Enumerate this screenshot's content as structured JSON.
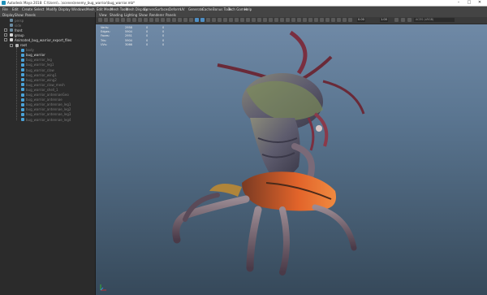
{
  "window": {
    "title": "Autodesk Maya 2018: C:\\Users\\...\\scenes\\enemy_bug_warrior\\bug_warrior.mb*",
    "controls": [
      "–",
      "□",
      "✕"
    ]
  },
  "menubar": [
    "File",
    "Edit",
    "Create",
    "Select",
    "Modify",
    "Display",
    "Windows",
    "Mesh",
    "Edit Mesh",
    "Mesh Tools",
    "Mesh Display",
    "Curves",
    "Surfaces",
    "Deform",
    "UV",
    "Generate",
    "Cache",
    "Bonus Tools",
    "Tech Games",
    "Help"
  ],
  "outliner": {
    "menu": [
      "Display",
      "Show",
      "Panels"
    ],
    "items": [
      {
        "label": "persp",
        "indent": 0,
        "expand": false,
        "icon": "camera-icon",
        "dim": true
      },
      {
        "label": "side",
        "indent": 0,
        "expand": false,
        "icon": "camera-icon",
        "dim": true
      },
      {
        "label": "front",
        "indent": 0,
        "expand": true,
        "icon": "camera-icon",
        "dim": false
      },
      {
        "label": "group",
        "indent": 0,
        "expand": true,
        "icon": "group-icon",
        "dim": false
      },
      {
        "label": "Animated_bug_warrior_export_files",
        "indent": 0,
        "expand": true,
        "icon": "group-icon",
        "dim": false
      },
      {
        "label": "root",
        "indent": 1,
        "expand": true,
        "icon": "joint-icon",
        "dim": false
      },
      {
        "label": "body",
        "indent": 2,
        "expand": false,
        "icon": "mesh-icon",
        "dim": true
      },
      {
        "label": "bug_warrior",
        "indent": 2,
        "expand": false,
        "icon": "mesh-icon",
        "dim": false,
        "selected": false
      },
      {
        "label": "bug_warrior_leg",
        "indent": 2,
        "expand": false,
        "icon": "mesh-icon",
        "dim": true
      },
      {
        "label": "bug_warrior_leg1",
        "indent": 2,
        "expand": false,
        "icon": "mesh-icon",
        "dim": true
      },
      {
        "label": "bug_warrior_claw",
        "indent": 2,
        "expand": false,
        "icon": "mesh-icon",
        "dim": true
      },
      {
        "label": "bug_warrior_wing1",
        "indent": 2,
        "expand": false,
        "icon": "mesh-icon",
        "dim": true
      },
      {
        "label": "bug_warrior_wing2",
        "indent": 2,
        "expand": false,
        "icon": "mesh-icon",
        "dim": true
      },
      {
        "label": "bug_warrior_claw_mesh",
        "indent": 2,
        "expand": false,
        "icon": "mesh-icon",
        "dim": true
      },
      {
        "label": "bug_warrior_shell_1",
        "indent": 2,
        "expand": false,
        "icon": "mesh-icon",
        "dim": true
      },
      {
        "label": "bug_warrior_antennaeGeo",
        "indent": 2,
        "expand": false,
        "icon": "mesh-icon",
        "dim": true
      },
      {
        "label": "bug_warrior_antennae",
        "indent": 2,
        "expand": false,
        "icon": "mesh-icon",
        "dim": true
      },
      {
        "label": "bug_warrior_antennae_leg1",
        "indent": 2,
        "expand": false,
        "icon": "mesh-icon",
        "dim": true
      },
      {
        "label": "bug_warrior_antennae_leg2",
        "indent": 2,
        "expand": false,
        "icon": "mesh-icon",
        "dim": true
      },
      {
        "label": "bug_warrior_antennae_leg3",
        "indent": 2,
        "expand": false,
        "icon": "mesh-icon",
        "dim": true
      },
      {
        "label": "bug_warrior_antennae_leg4",
        "indent": 2,
        "expand": false,
        "icon": "mesh-icon",
        "dim": true
      }
    ]
  },
  "viewport": {
    "menu": [
      "View",
      "Shading",
      "Lighting",
      "Show",
      "Renderer",
      "Panels"
    ],
    "toolbar": {
      "near_clip": "0.00",
      "far_clip": "1.00",
      "color_space": "ACES (sRGB)"
    },
    "hud": [
      {
        "label": "Verts:",
        "a": "2958",
        "b": "0",
        "c": "0"
      },
      {
        "label": "Edges:",
        "a": "5904",
        "b": "0",
        "c": "0"
      },
      {
        "label": "Faces:",
        "a": "2951",
        "b": "0",
        "c": "0"
      },
      {
        "label": "Tris:",
        "a": "5904",
        "b": "0",
        "c": "0"
      },
      {
        "label": "UVs:",
        "a": "3066",
        "b": "0",
        "c": "0"
      }
    ],
    "axis": {
      "x": "x",
      "y": "y",
      "z": "z"
    }
  },
  "colors": {
    "selection": "#3c5a78",
    "accent": "#4f8ec4",
    "creature_body": "#6a6878",
    "creature_orange": "#e0602a",
    "creature_horn": "#7a2f40"
  }
}
